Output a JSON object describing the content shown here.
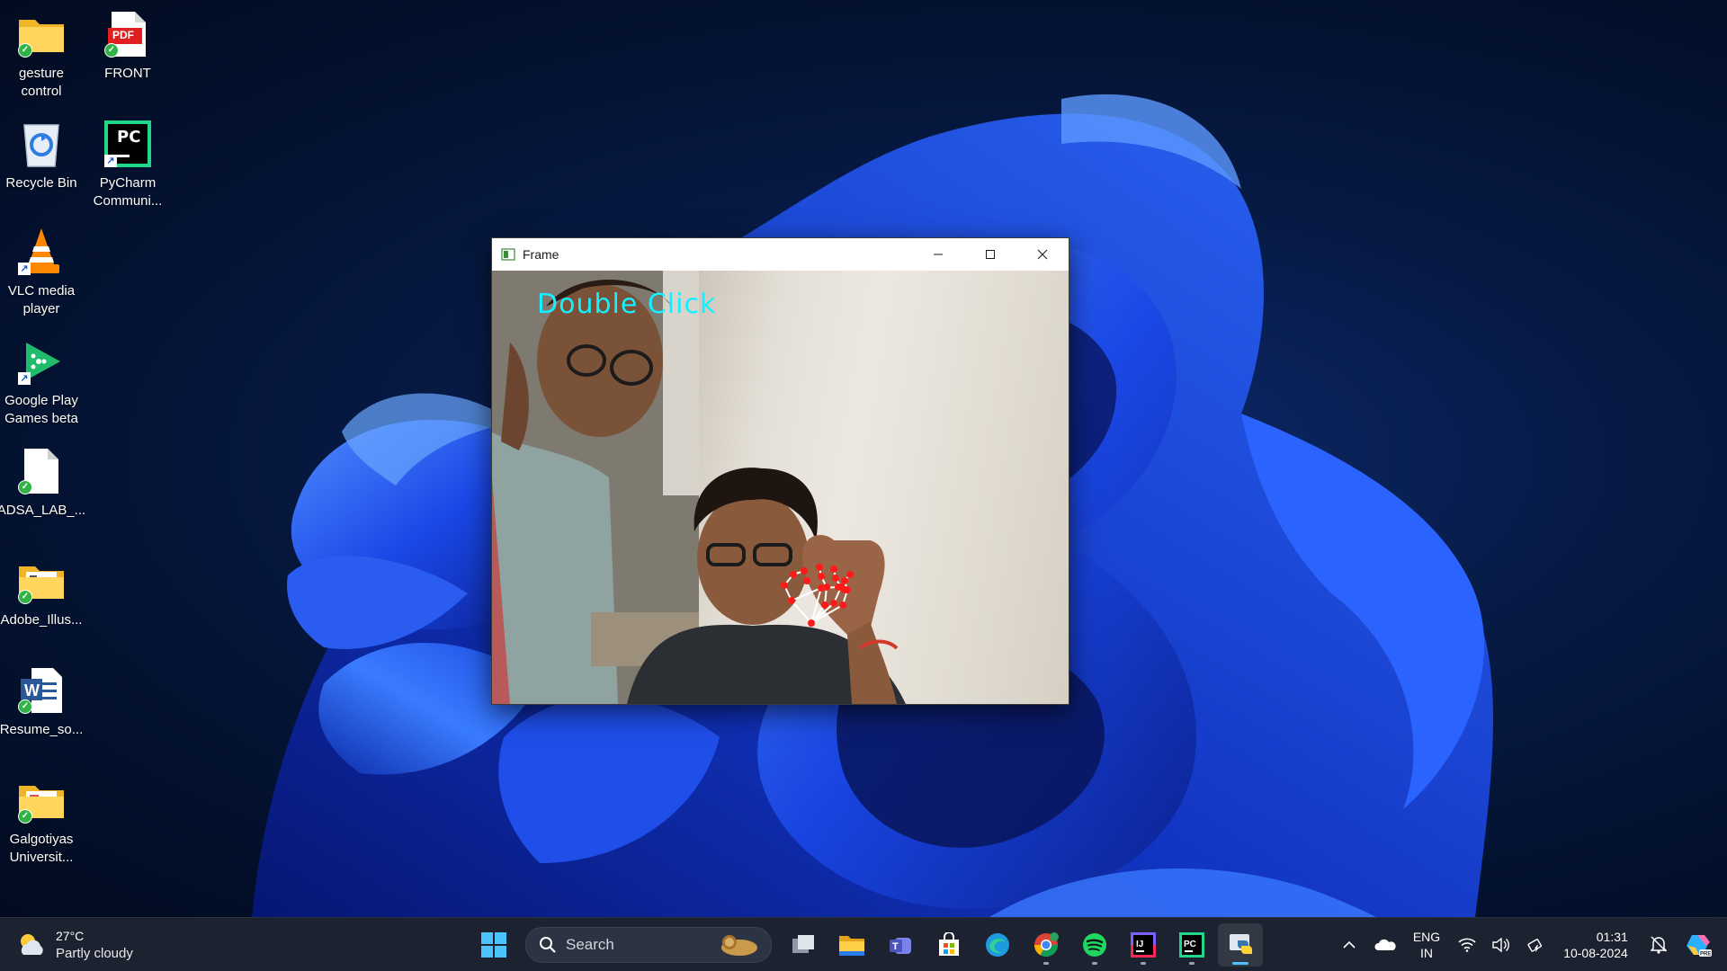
{
  "desktop": {
    "icons": [
      {
        "label": "gesture\ncontrol",
        "icon": "folder-icon"
      },
      {
        "label": "FRONT",
        "icon": "pdf-icon",
        "badge_text": "PDF"
      },
      {
        "label": "Recycle Bin",
        "icon": "recycle-bin-icon"
      },
      {
        "label": "PyCharm\nCommuni...",
        "icon": "pycharm-icon",
        "badge_text": "PC"
      },
      {
        "label": "VLC media\nplayer",
        "icon": "vlc-icon"
      },
      {
        "label": "Google Play\nGames beta",
        "icon": "google-play-games-icon"
      },
      {
        "label": "ADSA_LAB_...",
        "icon": "document-icon"
      },
      {
        "label": "Adobe_Illus...",
        "icon": "folder-icon"
      },
      {
        "label": "Resume_so...",
        "icon": "word-document-icon"
      },
      {
        "label": "Galgotiyas\nUniversit...",
        "icon": "folder-icon"
      }
    ]
  },
  "window": {
    "title": "Frame",
    "overlay_text": "Double Click",
    "controls": [
      "minimize",
      "maximize",
      "close"
    ]
  },
  "taskbar": {
    "weather": {
      "temp": "27°C",
      "condition": "Partly cloudy"
    },
    "search_placeholder": "Search",
    "apps": [
      "start",
      "task-view",
      "file-explorer",
      "teams",
      "microsoft-store",
      "edge",
      "chrome",
      "spotify",
      "intellij",
      "pycharm",
      "python"
    ],
    "active_app": "python",
    "tray": {
      "lang_line1": "ENG",
      "lang_line2": "IN",
      "time": "01:31",
      "date": "10-08-2024"
    }
  },
  "colors": {
    "overlay_text": "#14f0ff",
    "landmark_point": "#ff1a1a",
    "landmark_line": "#ffffff",
    "taskbar_bg": "#1c2230",
    "active_indicator": "#4cc2ff"
  }
}
